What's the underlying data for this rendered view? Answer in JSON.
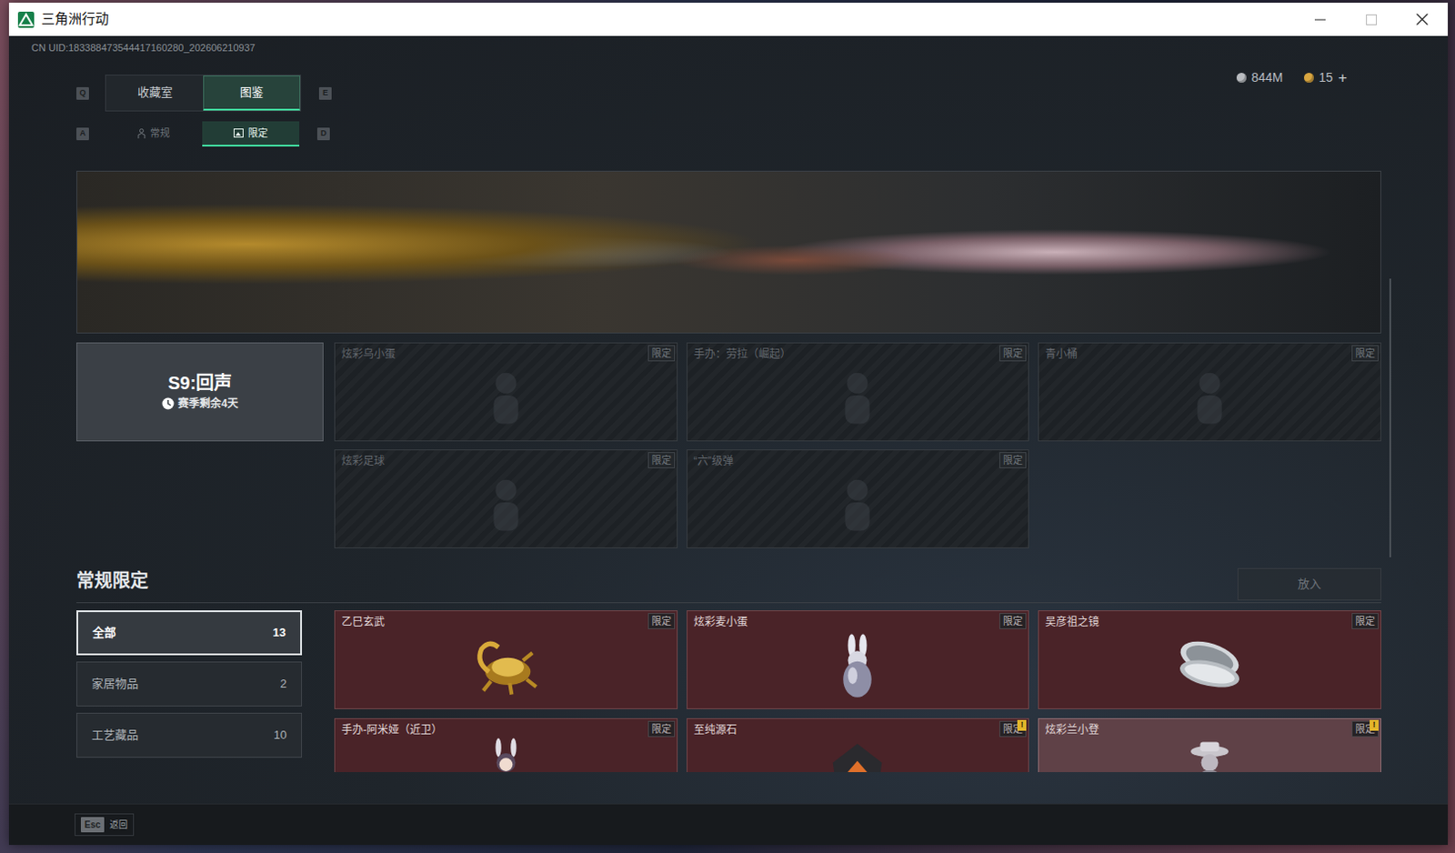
{
  "window": {
    "title": "三角洲行动"
  },
  "uid": "CN UID:183388473544417160280_202606210937",
  "currencies": [
    {
      "amount": "844M",
      "color": "#b9bcc0"
    },
    {
      "amount": "15",
      "color": "#d9a640"
    }
  ],
  "add_label": "+",
  "tabs": {
    "prev_key": "Q",
    "next_key": "E",
    "items": [
      {
        "label": "收藏室",
        "selected": false
      },
      {
        "label": "图鉴",
        "selected": true
      }
    ]
  },
  "subtabs": {
    "prev_key": "A",
    "next_key": "D",
    "items": [
      {
        "label": "常规",
        "selected": false
      },
      {
        "label": "限定",
        "selected": true
      }
    ]
  },
  "season": {
    "title": "S9:回声",
    "remaining": "赛季剩余4天",
    "items": [
      {
        "name": "炫彩乌小蛋",
        "tag": "限定",
        "owned": false
      },
      {
        "name": "手办：劳拉（崛起）",
        "tag": "限定",
        "owned": false
      },
      {
        "name": "青小桶",
        "tag": "限定",
        "owned": false
      },
      {
        "name": "炫彩足球",
        "tag": "限定",
        "owned": false
      },
      {
        "name": "“六”级弹",
        "tag": "限定",
        "owned": false
      }
    ]
  },
  "section": {
    "title": "常规限定",
    "action": {
      "label": "放入",
      "disabled": true
    }
  },
  "categories": [
    {
      "label": "全部",
      "count": "13",
      "selected": true
    },
    {
      "label": "家居物品",
      "count": "2",
      "selected": false
    },
    {
      "label": "工艺藏品",
      "count": "10",
      "selected": false
    }
  ],
  "collection": {
    "new_mark": "!",
    "items": [
      {
        "name": "乙巳玄武",
        "tag": "限定",
        "new": false,
        "highlighted": false
      },
      {
        "name": "炫彩麦小蛋",
        "tag": "限定",
        "new": false,
        "highlighted": false
      },
      {
        "name": "吴彦祖之镜",
        "tag": "限定",
        "new": false,
        "highlighted": false
      },
      {
        "name": "手办-阿米娅（近卫）",
        "tag": "限定",
        "new": false,
        "highlighted": false
      },
      {
        "name": "至纯源石",
        "tag": "限定",
        "new": true,
        "highlighted": false
      },
      {
        "name": "炫彩兰小登",
        "tag": "限定",
        "new": true,
        "highlighted": true
      }
    ]
  },
  "footer": {
    "key": "Esc",
    "label": "返回"
  }
}
